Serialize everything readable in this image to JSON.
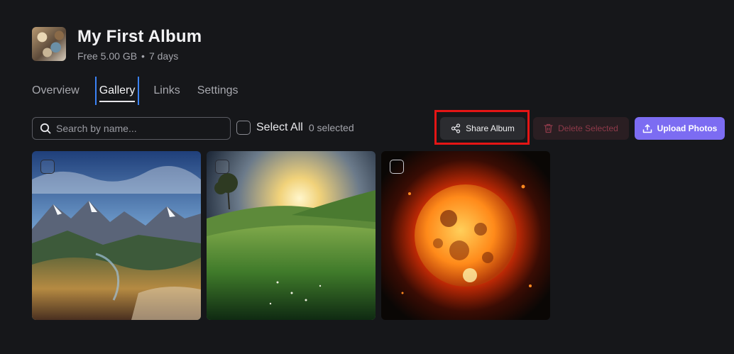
{
  "album": {
    "title": "My First Album",
    "storage": "Free 5.00 GB",
    "separator": "•",
    "age": "7 days"
  },
  "tabs": [
    {
      "label": "Overview",
      "active": false
    },
    {
      "label": "Gallery",
      "active": true
    },
    {
      "label": "Links",
      "active": false
    },
    {
      "label": "Settings",
      "active": false
    }
  ],
  "toolbar": {
    "search_placeholder": "Search by name...",
    "search_value": "",
    "select_all_label": "Select All",
    "selected_count": "0 selected",
    "share_label": "Share Album",
    "delete_label": "Delete Selected",
    "upload_label": "Upload Photos"
  },
  "photos": [
    {
      "subject": "mountain-valley",
      "selected": false
    },
    {
      "subject": "green-hills-sunset",
      "selected": false
    },
    {
      "subject": "burning-sun",
      "selected": false
    }
  ],
  "colors": {
    "background": "#16171a",
    "accent": "#7c6cf2",
    "danger_text": "#8e3a4a",
    "tab_focus": "#3b82f6",
    "highlight": "#e41515"
  }
}
